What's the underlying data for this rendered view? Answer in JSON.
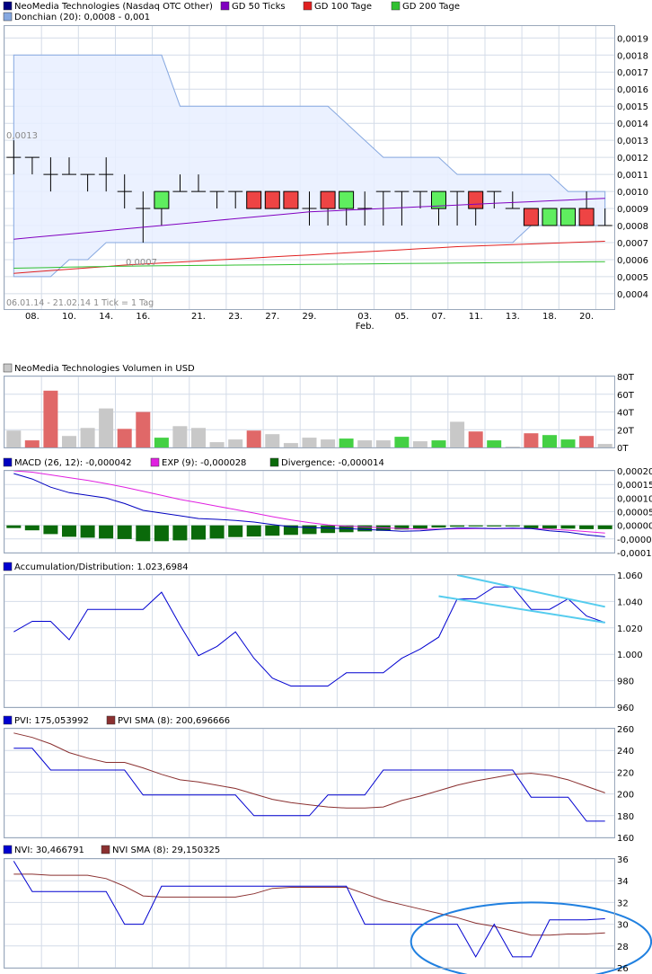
{
  "colors": {
    "donchian_fill": "#e8efff",
    "donchian_line": "#86a8e0",
    "ma50": "#8000c0",
    "ma100": "#e02020",
    "ma200": "#30c030",
    "candle_up": "#5fee5f",
    "candle_down": "#ee4444",
    "vol_up": "#44d044",
    "vol_down": "#e06868",
    "vol_flat": "#c8c8c8",
    "macd": "#0000c0",
    "exp": "#e020e0",
    "divergence": "#0a6a0a",
    "ad_line": "#0000d0",
    "trend_line": "#55ccee",
    "pvi": "#0000d0",
    "pvi_sma": "#8a3030",
    "nvi": "#0000d0",
    "nvi_sma": "#8a3030",
    "ellipse": "#2080e0"
  },
  "chart_data": [
    {
      "type": "candlestick",
      "id": "price",
      "legend": [
        {
          "label": "NeoMedia Technologies (Nasdaq OTC Other)",
          "color": "#000000"
        },
        {
          "label": "GD 50 Ticks",
          "color": "#8000c0"
        },
        {
          "label": "GD 100 Tage",
          "color": "#e02020"
        },
        {
          "label": "GD 200 Tage",
          "color": "#30c030"
        },
        {
          "label": "Donchian (20): 0,0008 - 0,001",
          "color": "#86a8e0"
        }
      ],
      "info_text": "06.01.14 - 21.02.14   1 Tick = 1 Tag",
      "annotations": {
        "high_label": "0,0013",
        "low_label": "0,0007"
      },
      "x_ticks": [
        "08.",
        "10.",
        "14.",
        "16.",
        "21.",
        "23.",
        "27.",
        "29.",
        "03.",
        "05.",
        "07.",
        "11.",
        "13.",
        "18.",
        "20."
      ],
      "x_tick_index": [
        1,
        3,
        5,
        7,
        10,
        12,
        14,
        16,
        19,
        21,
        23,
        25,
        27,
        29,
        31
      ],
      "month_label": "Feb.",
      "month_label_index": 19,
      "y_ticks": [
        "0,0019",
        "0,0018",
        "0,0017",
        "0,0016",
        "0,0015",
        "0,0014",
        "0,0013",
        "0,0012",
        "0,0011",
        "0,0010",
        "0,0009",
        "0,0008",
        "0,0007",
        "0,0006",
        "0,0005",
        "0,0004"
      ],
      "ylim": [
        0.00031,
        0.00197
      ],
      "candles": [
        {
          "o": 0.0012,
          "h": 0.0013,
          "l": 0.0011,
          "c": 0.0012,
          "t": "flat"
        },
        {
          "o": 0.0012,
          "h": 0.0012,
          "l": 0.0011,
          "c": 0.0012,
          "t": "flat"
        },
        {
          "o": 0.0011,
          "h": 0.0012,
          "l": 0.001,
          "c": 0.0011,
          "t": "flat"
        },
        {
          "o": 0.0011,
          "h": 0.0012,
          "l": 0.0011,
          "c": 0.0011,
          "t": "flat"
        },
        {
          "o": 0.0011,
          "h": 0.0011,
          "l": 0.001,
          "c": 0.0011,
          "t": "flat"
        },
        {
          "o": 0.0011,
          "h": 0.0012,
          "l": 0.001,
          "c": 0.0011,
          "t": "flat"
        },
        {
          "o": 0.001,
          "h": 0.0011,
          "l": 0.0009,
          "c": 0.001,
          "t": "flat"
        },
        {
          "o": 0.0009,
          "h": 0.001,
          "l": 0.0007,
          "c": 0.0009,
          "t": "flat"
        },
        {
          "o": 0.0009,
          "h": 0.001,
          "l": 0.0008,
          "c": 0.001,
          "t": "up"
        },
        {
          "o": 0.001,
          "h": 0.0011,
          "l": 0.001,
          "c": 0.001,
          "t": "flat"
        },
        {
          "o": 0.001,
          "h": 0.0011,
          "l": 0.001,
          "c": 0.001,
          "t": "flat"
        },
        {
          "o": 0.001,
          "h": 0.001,
          "l": 0.0009,
          "c": 0.001,
          "t": "flat"
        },
        {
          "o": 0.001,
          "h": 0.001,
          "l": 0.0009,
          "c": 0.001,
          "t": "flat"
        },
        {
          "o": 0.001,
          "h": 0.001,
          "l": 0.0009,
          "c": 0.0009,
          "t": "down"
        },
        {
          "o": 0.001,
          "h": 0.001,
          "l": 0.0009,
          "c": 0.0009,
          "t": "down"
        },
        {
          "o": 0.001,
          "h": 0.001,
          "l": 0.0009,
          "c": 0.0009,
          "t": "down"
        },
        {
          "o": 0.0009,
          "h": 0.001,
          "l": 0.0008,
          "c": 0.0009,
          "t": "flat"
        },
        {
          "o": 0.001,
          "h": 0.001,
          "l": 0.0008,
          "c": 0.0009,
          "t": "down"
        },
        {
          "o": 0.0009,
          "h": 0.001,
          "l": 0.0008,
          "c": 0.001,
          "t": "up"
        },
        {
          "o": 0.0009,
          "h": 0.001,
          "l": 0.0008,
          "c": 0.0009,
          "t": "flat"
        },
        {
          "o": 0.001,
          "h": 0.001,
          "l": 0.0008,
          "c": 0.001,
          "t": "flat"
        },
        {
          "o": 0.001,
          "h": 0.001,
          "l": 0.0008,
          "c": 0.001,
          "t": "flat"
        },
        {
          "o": 0.001,
          "h": 0.001,
          "l": 0.0009,
          "c": 0.001,
          "t": "flat"
        },
        {
          "o": 0.0009,
          "h": 0.001,
          "l": 0.0008,
          "c": 0.001,
          "t": "up"
        },
        {
          "o": 0.001,
          "h": 0.001,
          "l": 0.0008,
          "c": 0.001,
          "t": "flat"
        },
        {
          "o": 0.001,
          "h": 0.001,
          "l": 0.0008,
          "c": 0.0009,
          "t": "down"
        },
        {
          "o": 0.001,
          "h": 0.001,
          "l": 0.0009,
          "c": 0.001,
          "t": "flat"
        },
        {
          "o": 0.0009,
          "h": 0.001,
          "l": 0.0009,
          "c": 0.0009,
          "t": "flat"
        },
        {
          "o": 0.0009,
          "h": 0.0009,
          "l": 0.0008,
          "c": 0.0008,
          "t": "down"
        },
        {
          "o": 0.0008,
          "h": 0.0009,
          "l": 0.0008,
          "c": 0.0009,
          "t": "up"
        },
        {
          "o": 0.0008,
          "h": 0.0009,
          "l": 0.0008,
          "c": 0.0009,
          "t": "up"
        },
        {
          "o": 0.0009,
          "h": 0.001,
          "l": 0.0008,
          "c": 0.0008,
          "t": "down"
        },
        {
          "o": 0.0009,
          "h": 0.0009,
          "l": 0.0008,
          "c": 0.0008,
          "t": "flat"
        }
      ],
      "ma50": [
        0.00072,
        0.00073,
        0.00074,
        0.00075,
        0.00076,
        0.00077,
        0.00078,
        0.00079,
        0.0008,
        0.00081,
        0.00082,
        0.00083,
        0.00084,
        0.00085,
        0.00086,
        0.00087,
        0.00088,
        0.000885,
        0.00089,
        0.000895,
        0.0009,
        0.000905,
        0.00091,
        0.000915,
        0.00092,
        0.000925,
        0.00093,
        0.000935,
        0.00094,
        0.000945,
        0.00095,
        0.000955,
        0.00096
      ],
      "ma100": [
        0.00052,
        0.000528,
        0.000536,
        0.000544,
        0.000552,
        0.00056,
        0.000568,
        0.000574,
        0.00058,
        0.000586,
        0.000592,
        0.000598,
        0.000604,
        0.00061,
        0.000616,
        0.000622,
        0.000628,
        0.000634,
        0.00064,
        0.000646,
        0.000652,
        0.000658,
        0.000664,
        0.00067,
        0.000676,
        0.00068,
        0.000684,
        0.000688,
        0.000692,
        0.000696,
        0.0007,
        0.000704,
        0.000708
      ],
      "ma200": [
        0.00055,
        0.000552,
        0.000554,
        0.000556,
        0.000558,
        0.00056,
        0.000562,
        0.000563,
        0.000564,
        0.000565,
        0.000566,
        0.000567,
        0.000568,
        0.000569,
        0.00057,
        0.000571,
        0.000572,
        0.000573,
        0.000574,
        0.000575,
        0.000576,
        0.000577,
        0.000578,
        0.000579,
        0.00058,
        0.000581,
        0.000582,
        0.000583,
        0.000584,
        0.000585,
        0.000586,
        0.000587,
        0.000588
      ],
      "donchian_upper": [
        0.0018,
        0.0018,
        0.0018,
        0.0018,
        0.0018,
        0.0018,
        0.0018,
        0.0018,
        0.0018,
        0.0015,
        0.0015,
        0.0015,
        0.0015,
        0.0015,
        0.0015,
        0.0015,
        0.0015,
        0.0015,
        0.0014,
        0.0013,
        0.0012,
        0.0012,
        0.0012,
        0.0012,
        0.0011,
        0.0011,
        0.0011,
        0.0011,
        0.0011,
        0.0011,
        0.001,
        0.001,
        0.001
      ],
      "donchian_lower": [
        0.0005,
        0.0005,
        0.0005,
        0.0006,
        0.0006,
        0.0007,
        0.0007,
        0.0007,
        0.0007,
        0.0007,
        0.0007,
        0.0007,
        0.0007,
        0.0007,
        0.0007,
        0.0007,
        0.0007,
        0.0007,
        0.0007,
        0.0007,
        0.0007,
        0.0007,
        0.0007,
        0.0007,
        0.0007,
        0.0007,
        0.0007,
        0.0007,
        0.0008,
        0.0008,
        0.0008,
        0.0008,
        0.0008
      ]
    },
    {
      "type": "bar",
      "id": "volume",
      "legend": [
        {
          "label": "NeoMedia Technologies Volumen in USD",
          "color": "#c8c8c8"
        }
      ],
      "y_ticks": [
        "80T",
        "60T",
        "40T",
        "20T",
        "0T"
      ],
      "ylim": [
        0,
        80
      ],
      "values": [
        19,
        8,
        64,
        13,
        22,
        44,
        21,
        40,
        11,
        24,
        22,
        6,
        9,
        19,
        15,
        5,
        11,
        9,
        10,
        8,
        8,
        12,
        7,
        8,
        29,
        18,
        8,
        1,
        16,
        14,
        9,
        13,
        4
      ],
      "kinds": [
        "flat",
        "down",
        "down",
        "flat",
        "flat",
        "flat",
        "down",
        "down",
        "up",
        "flat",
        "flat",
        "flat",
        "flat",
        "down",
        "flat",
        "flat",
        "flat",
        "flat",
        "up",
        "flat",
        "flat",
        "up",
        "flat",
        "up",
        "flat",
        "down",
        "up",
        "flat",
        "down",
        "up",
        "up",
        "down",
        "flat"
      ]
    },
    {
      "type": "line",
      "id": "macd",
      "legend": [
        {
          "label": "MACD (26, 12): -0,000042",
          "color": "#0000c0"
        },
        {
          "label": "EXP (9): -0,000028",
          "color": "#e020e0"
        },
        {
          "label": "Divergence: -0,000014",
          "color": "#0a6a0a"
        }
      ],
      "y_ticks": [
        "0,00020",
        "0,00015",
        "0,00010",
        "0,00005",
        "0,00000",
        "-0,00005",
        "-0,00010"
      ],
      "ylim": [
        -0.0001,
        0.0002
      ],
      "macd": [
        0.00019,
        0.00017,
        0.00014,
        0.00012,
        0.00011,
        0.0001,
        8e-05,
        5.5e-05,
        4.5e-05,
        3.5e-05,
        2.5e-05,
        2.2e-05,
        1.8e-05,
        1.2e-05,
        3e-06,
        -5e-06,
        -8e-06,
        -1e-05,
        -1.2e-05,
        -1.5e-05,
        -1.8e-05,
        -2.2e-05,
        -2e-05,
        -1.5e-05,
        -1e-05,
        -1e-05,
        -1.2e-05,
        -1e-05,
        -1.2e-05,
        -2e-05,
        -2.5e-05,
        -3.5e-05,
        -4.2e-05
      ],
      "exp": [
        0.0002,
        0.000195,
        0.000185,
        0.000175,
        0.000165,
        0.000153,
        0.00014,
        0.000125,
        0.00011,
        9.5e-05,
        8.3e-05,
        7e-05,
        5.8e-05,
        4.5e-05,
        3.2e-05,
        2e-05,
        1e-05,
        2e-06,
        -3e-06,
        -6e-06,
        -9e-06,
        -1.2e-05,
        -1.4e-05,
        -1.4e-05,
        -1.3e-05,
        -1.2e-05,
        -1.2e-05,
        -1.2e-05,
        -1.2e-05,
        -1.4e-05,
        -1.8e-05,
        -2.3e-05,
        -2.8e-05
      ],
      "divergence": [
        -1e-05,
        -1.8e-05,
        -3.2e-05,
        -4.2e-05,
        -4.5e-05,
        -4.8e-05,
        -5e-05,
        -5.8e-05,
        -5.8e-05,
        -5.5e-05,
        -5.2e-05,
        -4.8e-05,
        -4.3e-05,
        -4.1e-05,
        -3.8e-05,
        -3.5e-05,
        -3.2e-05,
        -2.8e-05,
        -2.5e-05,
        -2.2e-05,
        -2e-05,
        -1.5e-05,
        -1.2e-05,
        -8e-06,
        -5e-06,
        -4e-06,
        -4e-06,
        -4e-06,
        -1.2e-05,
        -1.2e-05,
        -1.2e-05,
        -1.4e-05,
        -1.4e-05
      ]
    },
    {
      "type": "line",
      "id": "ad",
      "legend": [
        {
          "label": "Accumulation/Distribution: 1.023,6984",
          "color": "#0000d0"
        }
      ],
      "y_ticks": [
        "1.060",
        "1.040",
        "1.020",
        "1.000",
        "980",
        "960"
      ],
      "ylim": [
        960,
        1060
      ],
      "values": [
        1017,
        1025,
        1025,
        1011,
        1034,
        1034,
        1034,
        1034,
        1047,
        1022,
        999,
        1006,
        1017,
        997,
        982,
        976,
        976,
        976,
        986,
        986,
        986,
        997,
        1004,
        1013,
        1042,
        1042,
        1051,
        1051,
        1034,
        1034,
        1042,
        1029,
        1024
      ],
      "trend_lines": [
        {
          "from_index": 24,
          "from": 1060,
          "to_index": 32,
          "to": 1036
        },
        {
          "from_index": 23,
          "from": 1044,
          "to_index": 32,
          "to": 1024
        }
      ]
    },
    {
      "type": "line",
      "id": "pvi",
      "legend": [
        {
          "label": "PVI: 175,053992",
          "color": "#0000d0"
        },
        {
          "label": "PVI SMA (8): 200,696666",
          "color": "#8a3030"
        }
      ],
      "y_ticks": [
        "260",
        "240",
        "220",
        "200",
        "180",
        "160"
      ],
      "ylim": [
        160,
        260
      ],
      "pvi": [
        242,
        242,
        222,
        222,
        222,
        222,
        222,
        199,
        199,
        199,
        199,
        199,
        199,
        180,
        180,
        180,
        180,
        199,
        199,
        199,
        222,
        222,
        222,
        222,
        222,
        222,
        222,
        222,
        197,
        197,
        197,
        175,
        175
      ],
      "pvi_sma": [
        256,
        252,
        246,
        238,
        233,
        229,
        229,
        224,
        218,
        213,
        211,
        208,
        205,
        200,
        195,
        192,
        190,
        188,
        187,
        187,
        188,
        194,
        198,
        203,
        208,
        212,
        215,
        218,
        219,
        217,
        213,
        207,
        201
      ]
    },
    {
      "type": "line",
      "id": "nvi",
      "legend": [
        {
          "label": "NVI: 30,466791",
          "color": "#0000d0"
        },
        {
          "label": "NVI SMA (8): 29,150325",
          "color": "#8a3030"
        }
      ],
      "y_ticks": [
        "36",
        "34",
        "32",
        "30",
        "28",
        "26"
      ],
      "ylim": [
        26,
        36
      ],
      "nvi": [
        35.8,
        33,
        33,
        33,
        33,
        33,
        30,
        30,
        33.5,
        33.5,
        33.5,
        33.5,
        33.5,
        33.5,
        33.5,
        33.5,
        33.5,
        33.5,
        33.5,
        30,
        30,
        30,
        30,
        30,
        30,
        27,
        30,
        27,
        27,
        30.4,
        30.4,
        30.4,
        30.5
      ],
      "nvi_sma": [
        34.6,
        34.6,
        34.5,
        34.5,
        34.5,
        34.2,
        33.5,
        32.6,
        32.5,
        32.5,
        32.5,
        32.5,
        32.5,
        32.8,
        33.3,
        33.4,
        33.4,
        33.4,
        33.4,
        32.8,
        32.2,
        31.8,
        31.4,
        31,
        30.6,
        30.1,
        29.8,
        29.4,
        29,
        29,
        29.1,
        29.1,
        29.2
      ],
      "highlight_ellipse": {
        "center_index": 28,
        "center": 28.4,
        "x_span": 6.5,
        "y_span": 3.6
      }
    }
  ]
}
